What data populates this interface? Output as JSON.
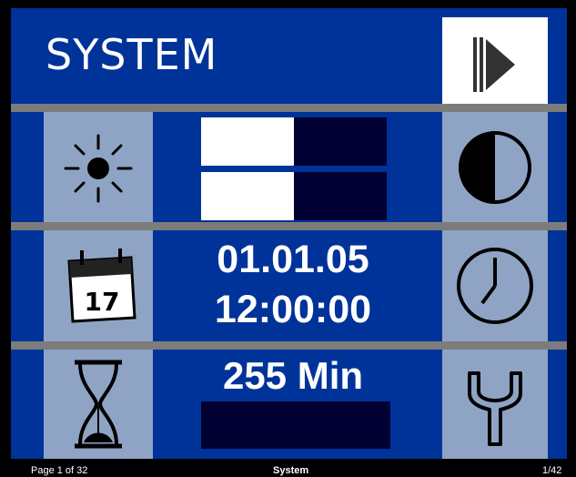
{
  "header": {
    "title": "SYSTEM",
    "next_icon": "play-next-icon"
  },
  "brightness": {
    "icon": "sun-icon",
    "level": 0.5
  },
  "contrast": {
    "icon": "half-circle-contrast-icon",
    "level": 0.5
  },
  "datetime": {
    "date": "01.01.05",
    "time": "12:00:00",
    "date_icon": "calendar-icon",
    "calendar_day": "17",
    "time_icon": "clock-icon"
  },
  "timer": {
    "value": "255 Min",
    "icon": "hourglass-icon",
    "settings_icon": "wrench-icon",
    "level": 0
  },
  "footer": {
    "page": "Page 1 of 32",
    "name": "System",
    "index": "1/42"
  },
  "colors": {
    "background": "#003399",
    "separator": "#7c7c7c",
    "icon_cell": "#8fa4c4",
    "bar_empty": "#000033",
    "bar_fill": "#ffffff"
  }
}
